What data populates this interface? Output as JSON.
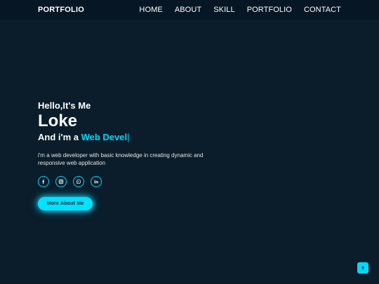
{
  "brand": {
    "logo": "PORTFOLIO"
  },
  "nav": {
    "items": [
      {
        "label": "HOME"
      },
      {
        "label": "ABOUT"
      },
      {
        "label": "SKILL"
      },
      {
        "label": "PORTFOLIO"
      },
      {
        "label": "CONTACT"
      }
    ]
  },
  "hero": {
    "greeting": "Hello,It's Me",
    "name": "Loke",
    "role_prefix": "And i'm a ",
    "role_typed": "Web Devel",
    "role_cursor": "|",
    "description": "i'm a web developer with basic knowledge in creating dynamic and responsive web application",
    "button_label": "More About Me"
  },
  "socials": [
    {
      "icon": "facebook-icon"
    },
    {
      "icon": "instagram-icon"
    },
    {
      "icon": "whatsapp-icon"
    },
    {
      "icon": "linkedin-icon"
    }
  ],
  "colors": {
    "accent": "#00d9ff",
    "background": "#0b1c2a",
    "navbar": "#071624",
    "text": "#ffffff"
  }
}
